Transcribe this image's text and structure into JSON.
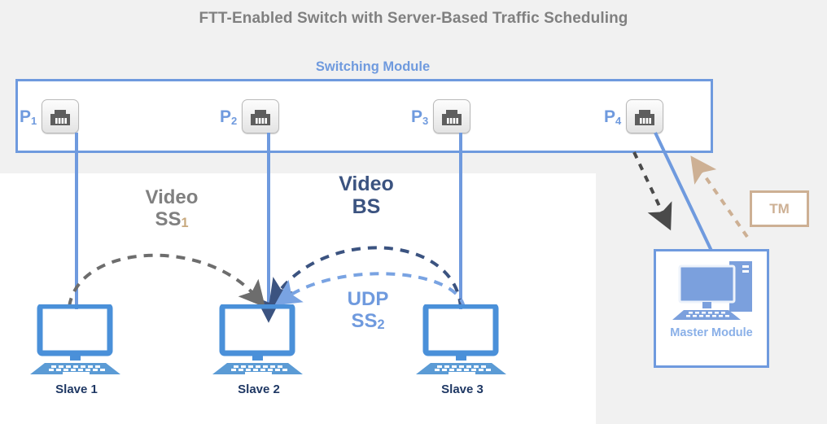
{
  "title": "FTT-Enabled Switch with Server-Based Traffic Scheduling",
  "switch": {
    "label": "Switching Module",
    "ports": [
      {
        "name": "P",
        "index": "1",
        "icon": "rj45-port-icon"
      },
      {
        "name": "P",
        "index": "2",
        "icon": "rj45-port-icon"
      },
      {
        "name": "P",
        "index": "3",
        "icon": "rj45-port-icon"
      },
      {
        "name": "P",
        "index": "4",
        "icon": "rj45-port-icon"
      }
    ]
  },
  "flows": [
    {
      "id": "video-ss1",
      "line1": "Video",
      "line2": "SS",
      "sub": "1",
      "color": "#808080",
      "from": "Slave 1",
      "to": "Slave 2",
      "style": "dashed"
    },
    {
      "id": "video-bs",
      "line1": "Video",
      "line2": "BS",
      "sub": "",
      "color": "#3b5380",
      "from": "Slave 3",
      "to": "Slave 2",
      "style": "dashed"
    },
    {
      "id": "udp-ss2",
      "line1": "UDP",
      "line2": "SS",
      "sub": "2",
      "color": "#6f9ade",
      "from": "Slave 3",
      "to": "Slave 2",
      "style": "dashed"
    }
  ],
  "nodes": [
    {
      "id": "slave-1",
      "caption": "Slave 1",
      "icon": "desktop-computer-icon",
      "port": "P1"
    },
    {
      "id": "slave-2",
      "caption": "Slave 2",
      "icon": "desktop-computer-icon",
      "port": "P2"
    },
    {
      "id": "slave-3",
      "caption": "Slave 3",
      "icon": "desktop-computer-icon",
      "port": "P3"
    }
  ],
  "master": {
    "caption": "Master Module",
    "icon": "desktop-tower-computer-icon",
    "port": "P4"
  },
  "tm": {
    "label": "TM"
  },
  "colors": {
    "accent_blue": "#6f9ade",
    "dark_navy": "#3b5380",
    "gray": "#808080",
    "tan": "#cdb094",
    "caption_navy": "#1f3864",
    "panel_gray": "#f1f1f1",
    "white": "#ffffff"
  }
}
